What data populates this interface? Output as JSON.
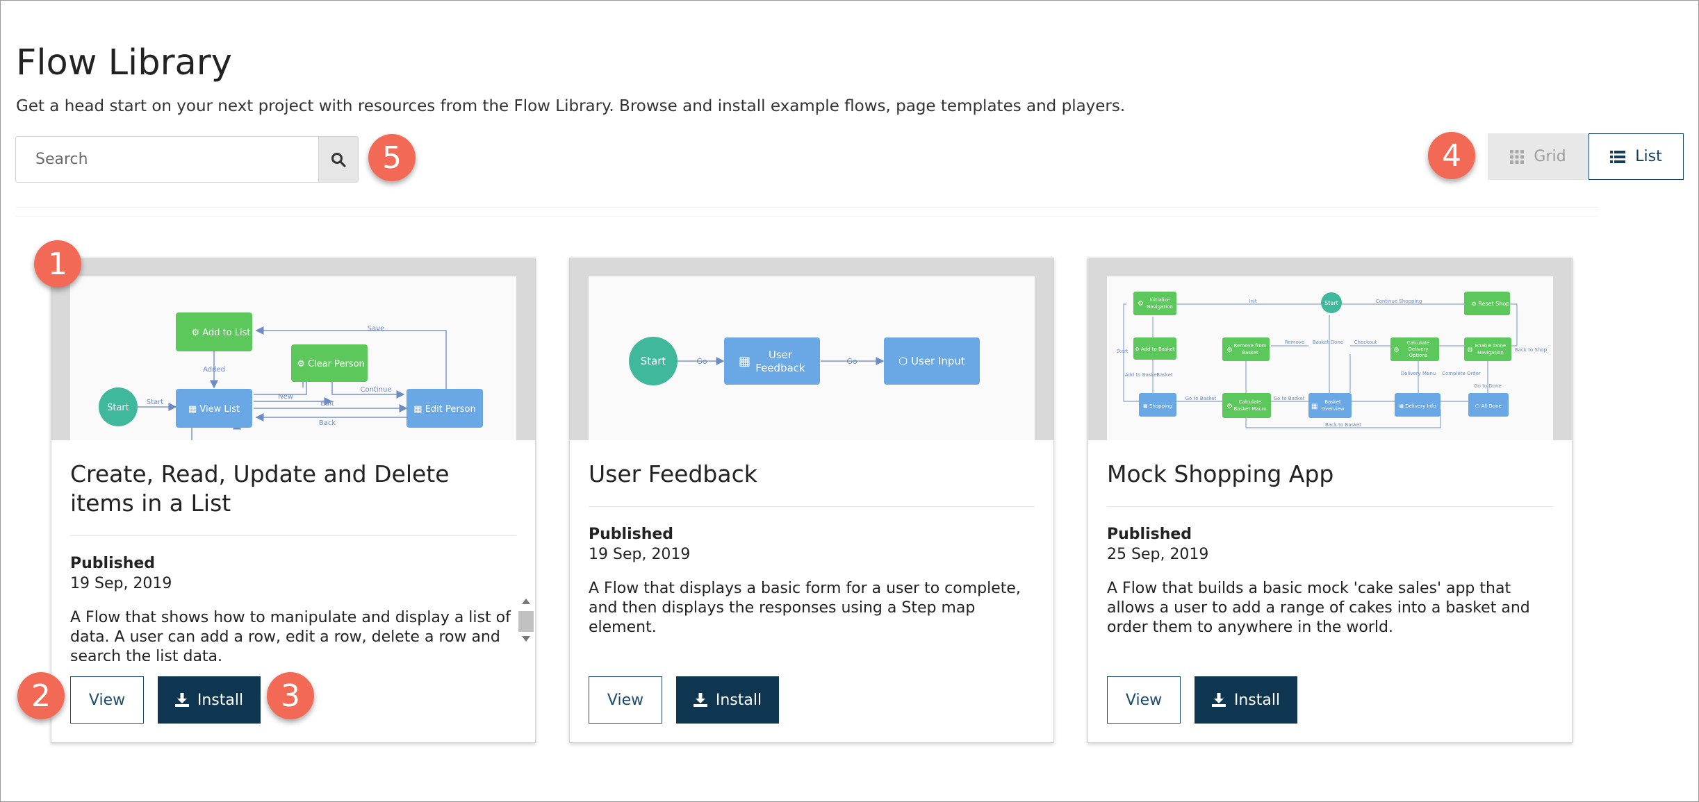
{
  "page": {
    "title": "Flow Library",
    "subtitle": "Get a head start on your next project with resources from the Flow Library. Browse and install example flows, page templates and players."
  },
  "search": {
    "placeholder": "Search"
  },
  "view_toggle": {
    "grid_label": "Grid",
    "list_label": "List",
    "selected": "List"
  },
  "callouts": [
    "1",
    "2",
    "3",
    "4",
    "5"
  ],
  "colors": {
    "badge": "#f26a55",
    "install_button": "#0e3651",
    "accent_border": "#1a4a6b",
    "flow_green": "#5cc75a",
    "flow_blue": "#69a8e4",
    "flow_teal": "#3fb89c"
  },
  "cards": [
    {
      "title": "Create, Read, Update and Delete items in a List",
      "status": "Published",
      "date": "19 Sep, 2019",
      "description": "A Flow that shows how to manipulate and display a list of data. A user can add a row, edit a row, delete a row and search the list data.",
      "view_label": "View",
      "install_label": "Install",
      "diagram": {
        "nodes": [
          "Start",
          "Add to List",
          "Clear Person",
          "View List",
          "Edit Person"
        ],
        "edges": [
          "Start",
          "Added",
          "New",
          "Edit",
          "Back",
          "Save",
          "Continue"
        ]
      }
    },
    {
      "title": "User Feedback",
      "status": "Published",
      "date": "19 Sep, 2019",
      "description": "A Flow that displays a basic form for a user to complete, and then displays the responses using a Step map element.",
      "view_label": "View",
      "install_label": "Install",
      "diagram": {
        "nodes": [
          "Start",
          "User Feedback",
          "User Input"
        ],
        "edges": [
          "Go",
          "Go"
        ]
      }
    },
    {
      "title": "Mock Shopping App",
      "status": "Published",
      "date": "25 Sep, 2019",
      "description": "A Flow that builds a basic mock 'cake sales' app that allows a user to add a range of cakes into a basket and order them to anywhere in the world.",
      "view_label": "View",
      "install_label": "Install",
      "diagram": {
        "nodes": [
          "Initialize Navigation",
          "Start",
          "Reset Shop",
          "Add to Basket",
          "Remove from Basket",
          "Calculate Delivery Options",
          "Enable Done Navigation",
          "Shopping",
          "Calculate Basket Macro",
          "Basket Overview",
          "Delivery Info",
          "All Done"
        ]
      }
    }
  ]
}
